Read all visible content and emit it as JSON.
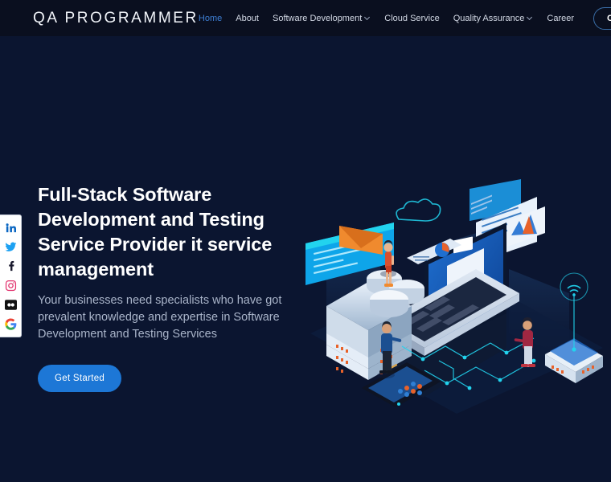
{
  "header": {
    "logo": "QA PROGRAMMER",
    "nav": [
      {
        "label": "Home",
        "active": true,
        "caret": false,
        "name": "nav-item-home"
      },
      {
        "label": "About",
        "active": false,
        "caret": false,
        "name": "nav-item-about"
      },
      {
        "label": "Software Development",
        "active": false,
        "caret": true,
        "name": "nav-item-software-development"
      },
      {
        "label": "Cloud Service",
        "active": false,
        "caret": false,
        "name": "nav-item-cloud-service"
      },
      {
        "label": "Quality Assurance",
        "active": false,
        "caret": true,
        "name": "nav-item-quality-assurance"
      },
      {
        "label": "Career",
        "active": false,
        "caret": false,
        "name": "nav-item-career"
      }
    ],
    "contact_label": "Contact Us"
  },
  "social": {
    "items": [
      {
        "name": "linkedin-icon",
        "label": "LinkedIn"
      },
      {
        "name": "twitter-icon",
        "label": "Twitter"
      },
      {
        "name": "facebook-icon",
        "label": "Facebook"
      },
      {
        "name": "instagram-icon",
        "label": "Instagram"
      },
      {
        "name": "flickr-icon",
        "label": "Flickr"
      },
      {
        "name": "google-icon",
        "label": "Google"
      }
    ]
  },
  "hero": {
    "title": "Full-Stack Software Development and Testing Service Provider it service management",
    "subtitle": "Your businesses need specialists who have got prevalent knowledge and expertise in Software Development and Testing Services",
    "cta_label": "Get Started",
    "illustration_name": "isometric-software-development-illustration"
  },
  "colors": {
    "header_bg": "#0a0f1f",
    "hero_bg": "#0b1530",
    "accent_blue": "#1d77d6",
    "active_nav": "#3e7fd4",
    "text_primary": "#ffffff",
    "text_muted": "#a9b4c9",
    "illustration_cyan": "#22d3ee",
    "illustration_orange": "#e8622a"
  }
}
